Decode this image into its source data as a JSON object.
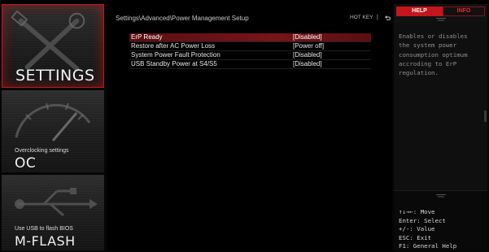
{
  "sidebar": {
    "settings": {
      "title": "SETTINGS"
    },
    "oc": {
      "subtitle": "Overclocking settings",
      "title": "OC"
    },
    "mflash": {
      "subtitle": "Use USB to flash BIOS",
      "title": "M-FLASH"
    }
  },
  "header": {
    "breadcrumb": "Settings\\Advanced\\Power Management Setup",
    "hotkey_label": "HOT KEY",
    "separator": "|"
  },
  "options": [
    {
      "name": "ErP Ready",
      "value": "[Disabled]",
      "selected": true
    },
    {
      "name": "Restore after AC Power Loss",
      "value": "[Power off]",
      "selected": false
    },
    {
      "name": "System Power Fault Protection",
      "value": "[Disabled]",
      "selected": false
    },
    {
      "name": "USB Standby Power at S4/S5",
      "value": "[Disabled]",
      "selected": false
    }
  ],
  "help_panel": {
    "tabs": {
      "help": "HELP",
      "info": "INFO"
    },
    "text_lines": [
      "Enables or disables",
      "the system power",
      "consumption optimum",
      "accroding to ErP",
      "regulation."
    ],
    "keys": [
      "↑↓→←: Move",
      "Enter: Select",
      "+/-: Value",
      "ESC: Exit",
      "F1: General Help"
    ]
  },
  "colors": {
    "accent": "#c4161c",
    "selected_row": "#761419",
    "background": "#000000",
    "help_text": "#8f8f8f"
  }
}
